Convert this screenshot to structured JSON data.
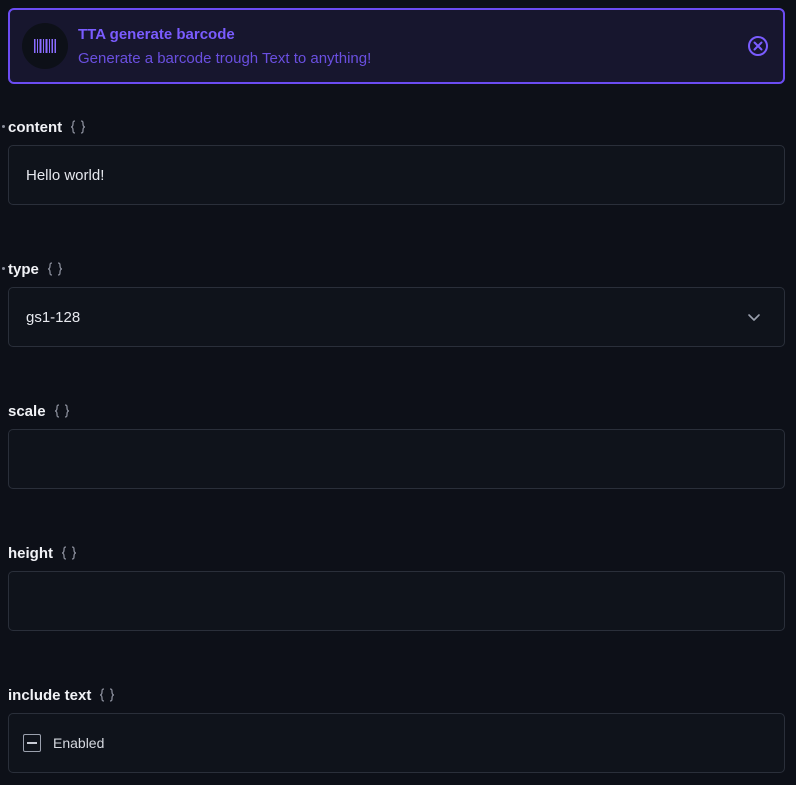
{
  "header": {
    "title": "TTA generate barcode",
    "subtitle": "Generate a barcode trough Text to anything!",
    "icon": "barcode-icon",
    "accent_color": "#6b4cf2"
  },
  "fields": {
    "content": {
      "label": "content",
      "required": true,
      "value": "Hello world!"
    },
    "type": {
      "label": "type",
      "required": true,
      "selected": "gs1-128"
    },
    "scale": {
      "label": "scale",
      "required": false,
      "value": ""
    },
    "height": {
      "label": "height",
      "required": false,
      "value": ""
    },
    "include_text": {
      "label": "include text",
      "required": false,
      "checkbox_label": "Enabled",
      "state": "indeterminate"
    }
  }
}
